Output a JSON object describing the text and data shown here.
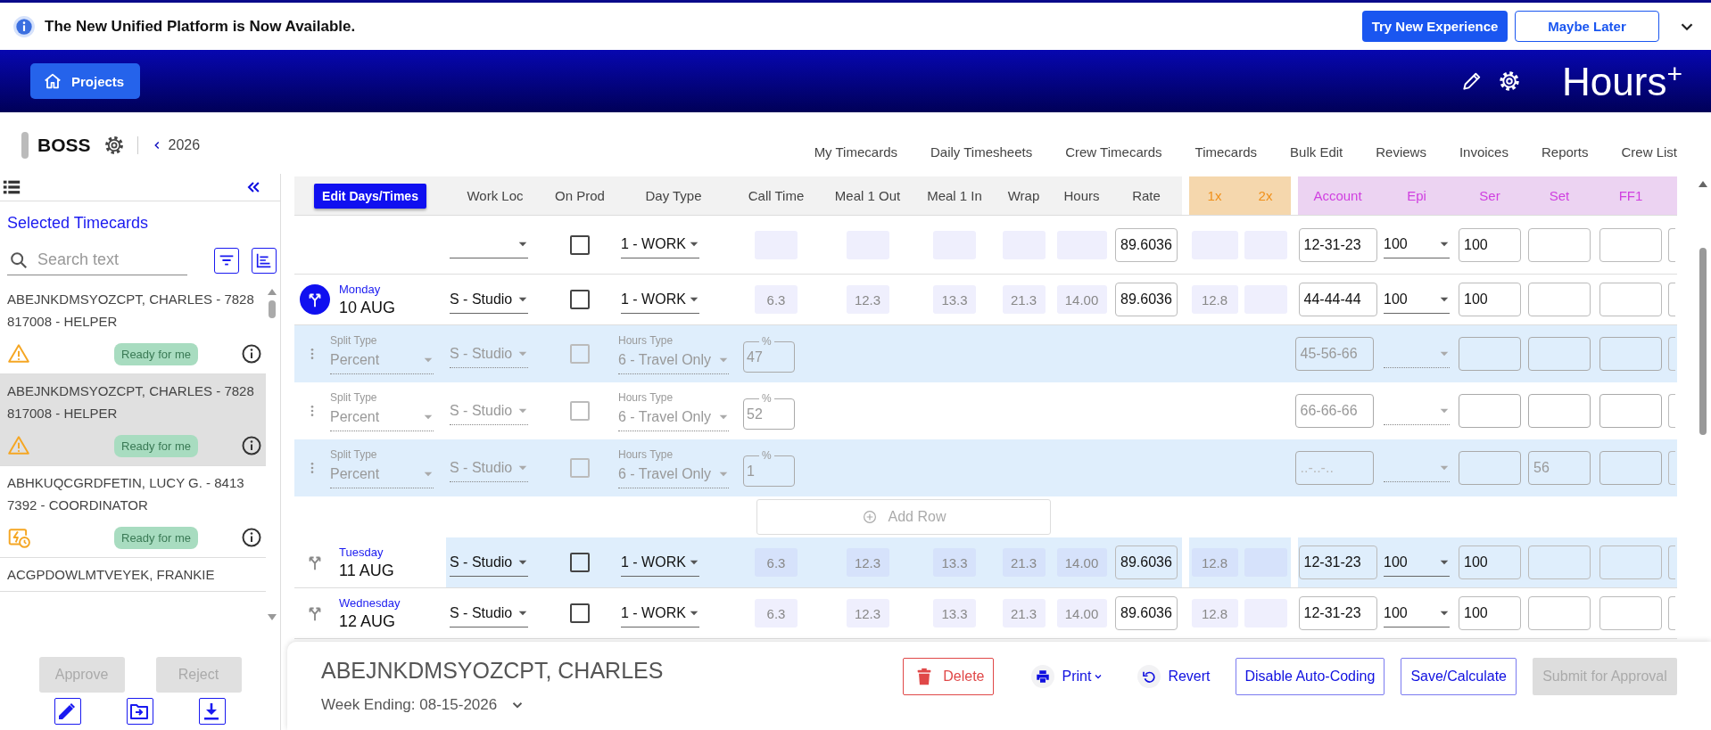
{
  "banner": {
    "message": "The New Unified Platform is Now Available.",
    "primary_button": "Try New Experience",
    "secondary_button": "Maybe Later"
  },
  "header": {
    "projects_button": "Projects",
    "app_name": "Hours$^{+}$"
  },
  "project": {
    "name": "BOSS",
    "year": "2026"
  },
  "nav": [
    {
      "label": "My Timecards"
    },
    {
      "label": "Daily Timesheets"
    },
    {
      "label": "Crew Timecards"
    },
    {
      "label": "Timecards"
    },
    {
      "label": "Bulk Edit"
    },
    {
      "label": "Reviews"
    },
    {
      "label": "Invoices"
    },
    {
      "label": "Reports"
    },
    {
      "label": "Crew List"
    }
  ],
  "sidebar": {
    "title": "Selected Timecards",
    "search": {
      "placeholder": "Search text"
    },
    "timecards": [
      {
        "name": "ABEJNKDMSYOZCPT, CHARLES - 7828",
        "role": "817008 - HELPER",
        "kind": "warning",
        "status": "Ready for me",
        "selected": false
      },
      {
        "name": "ABEJNKDMSYOZCPT, CHARLES - 7828",
        "role": "817008 - HELPER",
        "kind": "warning",
        "status": "Ready for me",
        "selected": true
      },
      {
        "name": "ABHKUQCGRDFETIN, LUCY G. - 8413",
        "role": "7392 - COORDINATOR",
        "kind": "meal",
        "status": "Ready for me",
        "selected": false
      },
      {
        "name": "ACGPDOWLMTVEYEK, FRANKIE",
        "kind": "plain",
        "selected": false
      }
    ],
    "actions": [
      {
        "label": "Approve",
        "disabled": true
      },
      {
        "label": "Reject",
        "disabled": true
      }
    ]
  },
  "timesheet": {
    "edit_button": "Edit Days/Times",
    "column_groups": [
      {
        "kind": "main",
        "columns": [
          {
            "label": "Work Loc",
            "kind": "select"
          },
          {
            "label": "On Prod",
            "kind": "check"
          },
          {
            "label": "Day Type",
            "kind": "select"
          },
          {
            "label": "Call Time",
            "kind": "readonly"
          },
          {
            "label": "Meal 1 Out",
            "kind": "readonly"
          },
          {
            "label": "Meal 1 In",
            "kind": "readonly"
          },
          {
            "label": "Wrap",
            "kind": "readonly"
          },
          {
            "label": "Hours",
            "kind": "readonly"
          },
          {
            "label": "Rate",
            "kind": "input"
          }
        ]
      },
      {
        "kind": "overtime",
        "columns": [
          {
            "label": "1x",
            "kind": "readonly"
          },
          {
            "label": "2x",
            "kind": "readonly"
          }
        ]
      },
      {
        "kind": "coding",
        "columns": [
          {
            "label": "Account",
            "kind": "input"
          },
          {
            "label": "Epi",
            "kind": "select"
          },
          {
            "label": "Ser",
            "kind": "input"
          },
          {
            "label": "Set",
            "kind": "input"
          },
          {
            "label": "FF1",
            "kind": "input"
          }
        ]
      }
    ],
    "rows": [
      {
        "kind": "day",
        "highlighted": false,
        "cells": {
          "on_prod": false,
          "day_type": "1 - WORK",
          "rate": "89.6036",
          "account": "12-31-23",
          "epi": "100",
          "ser": "100"
        }
      },
      {
        "kind": "day",
        "weekday": "Monday",
        "date": "10 AUG",
        "split_active": true,
        "highlighted": false,
        "cells": {
          "work_loc": "S - Studio",
          "on_prod": false,
          "day_type": "1 - WORK",
          "call_time": "6.3",
          "meal1_out": "12.3",
          "meal1_in": "13.3",
          "wrap": "21.3",
          "hours": "14.00",
          "rate": "89.6036",
          "ot_1x": "12.8",
          "account": "44-44-44",
          "epi": "100",
          "ser": "100"
        }
      },
      {
        "kind": "split",
        "shaded": true,
        "split_type_label": "Split Type",
        "split_type": "Percent",
        "work_loc": "S - Studio",
        "on_prod": false,
        "hours_type_label": "Hours Type",
        "hours_type": "6 - Travel Only",
        "percent_label": "%",
        "percent": "47",
        "coding": {
          "account": "45-56-66"
        }
      },
      {
        "kind": "split",
        "shaded": false,
        "split_type_label": "Split Type",
        "split_type": "Percent",
        "work_loc": "S - Studio",
        "on_prod": false,
        "hours_type_label": "Hours Type",
        "hours_type": "6 - Travel Only",
        "percent_label": "%",
        "percent": "52",
        "coding": {
          "account": "66-66-66"
        }
      },
      {
        "kind": "split",
        "shaded": true,
        "split_type_label": "Split Type",
        "split_type": "Percent",
        "work_loc": "S - Studio",
        "on_prod": false,
        "hours_type_label": "Hours Type",
        "hours_type": "6 - Travel Only",
        "percent_label": "%",
        "percent": "1",
        "account_placeholder": "..-..-..",
        "coding": {
          "set": "56"
        }
      },
      {
        "kind": "add",
        "label": "Add Row"
      },
      {
        "kind": "day",
        "weekday": "Tuesday",
        "date": "11 AUG",
        "split_active": false,
        "highlighted": true,
        "cells": {
          "work_loc": "S - Studio",
          "on_prod": false,
          "day_type": "1 - WORK",
          "call_time": "6.3",
          "meal1_out": "12.3",
          "meal1_in": "13.3",
          "wrap": "21.3",
          "hours": "14.00",
          "rate": "89.6036",
          "ot_1x": "12.8",
          "account": "12-31-23",
          "epi": "100",
          "ser": "100"
        }
      },
      {
        "kind": "day",
        "weekday": "Wednesday",
        "date": "12 AUG",
        "split_active": false,
        "highlighted": false,
        "cells": {
          "work_loc": "S - Studio",
          "on_prod": false,
          "day_type": "1 - WORK",
          "call_time": "6.3",
          "meal1_out": "12.3",
          "meal1_in": "13.3",
          "wrap": "21.3",
          "hours": "14.00",
          "rate": "89.6036",
          "ot_1x": "12.8",
          "account": "12-31-23",
          "epi": "100",
          "ser": "100"
        }
      }
    ]
  },
  "timecard": {
    "name": "ABEJNKDMSYOZCPT, CHARLES",
    "week_ending": "Week Ending: 08-15-2026",
    "actions": [
      {
        "kind": "delete",
        "label": "Delete",
        "disabled": false
      },
      {
        "kind": "print",
        "label": "Print",
        "disabled": false
      },
      {
        "kind": "revert",
        "label": "Revert",
        "disabled": false
      },
      {
        "kind": "outline",
        "label": "Disable Auto-Coding",
        "disabled": false
      },
      {
        "kind": "outline",
        "label": "Save/Calculate",
        "disabled": false
      },
      {
        "kind": "solid",
        "label": "Submit for Approval",
        "disabled": true
      }
    ]
  }
}
